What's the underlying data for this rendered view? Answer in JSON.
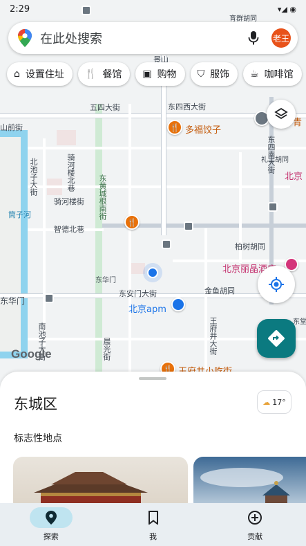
{
  "status_bar": {
    "time": "2:29",
    "right": "▾◢ ◉"
  },
  "search": {
    "placeholder": "在此处搜索",
    "avatar": "老王"
  },
  "chips": [
    "设置住址",
    "餐馆",
    "购物",
    "服饰",
    "咖啡馆"
  ],
  "map": {
    "streets": {
      "wusi": "五四大街",
      "dongsixi": "东四西大街",
      "shanqian": "山前街",
      "beichizi": "北池子大街",
      "qiheloubei": "骑河楼北巷",
      "qihelou": "骑河楼街",
      "donghuangcheng": "东黄城根南街",
      "tongzihe": "筒子河",
      "zhide": "智德北巷",
      "donghuamen": "东华门",
      "donghuamen2": "东华门",
      "donganmen": "东安门大街",
      "jinyu": "金鱼胡同",
      "baibai": "柏树胡同",
      "nanchizi": "南池子大街",
      "chenguang": "晨光街",
      "wangfujing_north": "王府井大街",
      "dongsinan": "东四南大街",
      "lishi": "礼士胡同",
      "yuzhong": "育群胡同",
      "jingshan": "景山",
      "dongtang": "东堂"
    },
    "pois": {
      "duofu": "多福饺子",
      "lijing": "北京丽晶酒店",
      "apm": "北京apm",
      "xiaochi": "王府井小吃街",
      "beijing_right": "北京",
      "qing": "青"
    },
    "google": "Google"
  },
  "sheet": {
    "title": "东城区",
    "weather": "17°",
    "section": "标志性地点"
  },
  "nav": {
    "items": [
      {
        "label": "探索",
        "icon": "location-pin-icon"
      },
      {
        "label": "我",
        "icon": "bookmark-icon"
      },
      {
        "label": "贡献",
        "icon": "add-circle-icon"
      }
    ]
  },
  "colors": {
    "accent": "#0b7a80",
    "nav_active": "#bfe4f0",
    "avatar": "#e8521a",
    "poi_orange": "#e8710a",
    "poi_blue": "#1a73e8",
    "poi_pink": "#d4357a"
  }
}
